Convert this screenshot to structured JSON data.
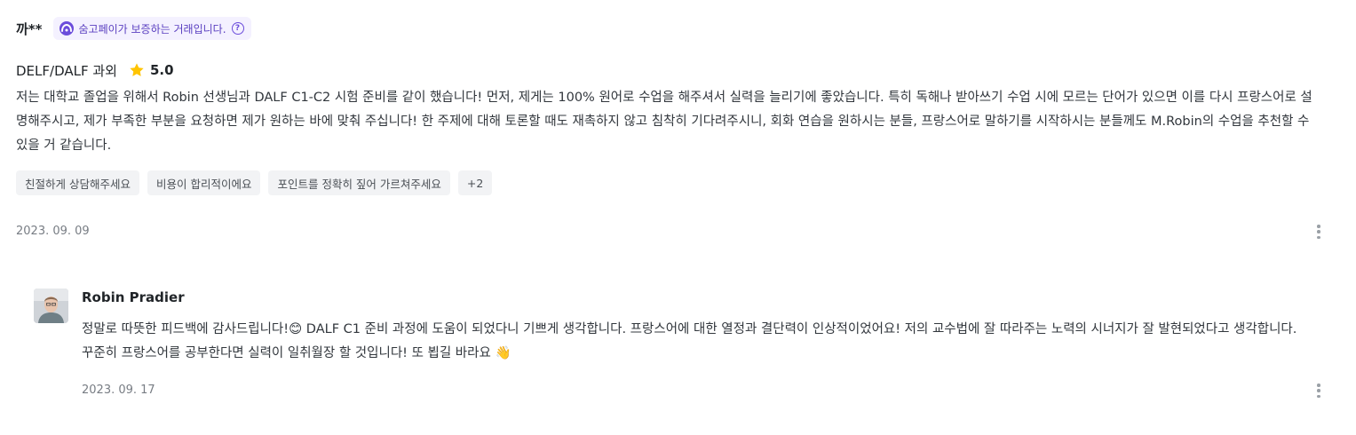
{
  "review": {
    "reviewer": "까**",
    "guarantee_badge": "숨고페이가 보증하는 거래입니다.",
    "guarantee_help": "?",
    "subject": "DELF/DALF 과외",
    "rating": "5.0",
    "body": "저는 대학교 졸업을 위해서 Robin 선생님과 DALF C1-C2 시험 준비를 같이 했습니다! 먼저, 제게는 100% 원어로 수업을 해주셔서 실력을 늘리기에 좋았습니다. 특히 독해나 받아쓰기 수업 시에 모르는 단어가 있으면 이를 다시 프랑스어로 설명해주시고, 제가 부족한 부분을 요청하면 제가 원하는 바에 맞춰 주십니다! 한 주제에 대해 토론할 때도 재촉하지 않고 침착히 기다려주시니, 회화 연습을 원하시는 분들, 프랑스어로 말하기를 시작하시는 분들께도 M.Robin의 수업을 추천할 수 있을 거 같습니다.",
    "tags": [
      "친절하게 상담해주세요",
      "비용이 합리적이에요",
      "포인트를 정확히 짚어 가르쳐주세요",
      "+2"
    ],
    "date": "2023. 09. 09"
  },
  "reply": {
    "name": "Robin Pradier",
    "body": "정말로 따뜻한 피드백에 감사드립니다!😊  DALF C1 준비 과정에 도움이 되었다니 기쁘게 생각합니다. 프랑스어에 대한 열정과 결단력이 인상적이었어요! 저의 교수법에 잘 따라주는 노력의 시너지가 잘 발현되었다고 생각합니다. 꾸준히 프랑스어를  공부한다면 실력이 일취월장 할 것입니다! 또 뵙길 바라요 👋",
    "date": "2023. 09. 17"
  },
  "icons": {
    "badge_logo": "soomgo-logo-icon",
    "help": "question-circle-icon",
    "rating": "star-icon",
    "more": "more-vertical-icon"
  },
  "colors": {
    "accent": "#6b4cdb",
    "badge_bg": "#f4f1ff",
    "star": "#ffc400",
    "tag_bg": "#f2f3f5"
  }
}
